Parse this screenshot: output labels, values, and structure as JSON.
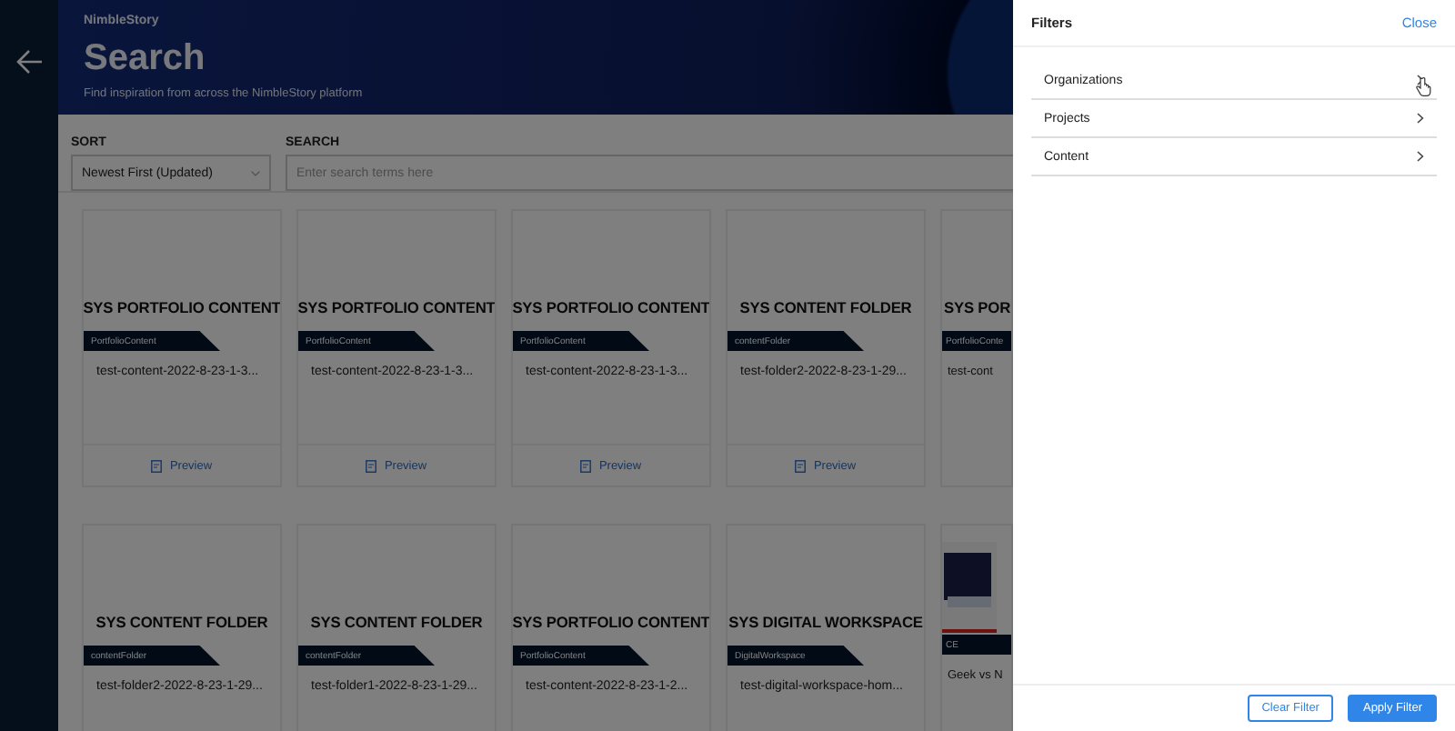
{
  "header": {
    "logo": "NimbleStory",
    "title": "Search",
    "subtitle": "Find inspiration from across the NimbleStory platform"
  },
  "sort": {
    "label": "SORT",
    "value": "Newest First (Updated)"
  },
  "search": {
    "label": "SEARCH",
    "placeholder": "Enter search terms here"
  },
  "card_rows": [
    {
      "cards": [
        {
          "kind": "text",
          "title": "SYS PORTFOLIO CONTENT",
          "tag": "PortfolioContent",
          "name": "test-content-2022-8-23-1-3...",
          "action": "Preview"
        },
        {
          "kind": "text",
          "title": "SYS PORTFOLIO CONTENT",
          "tag": "PortfolioContent",
          "name": "test-content-2022-8-23-1-3...",
          "action": "Preview"
        },
        {
          "kind": "text",
          "title": "SYS PORTFOLIO CONTENT",
          "tag": "PortfolioContent",
          "name": "test-content-2022-8-23-1-3...",
          "action": "Preview"
        },
        {
          "kind": "text",
          "title": "SYS CONTENT FOLDER",
          "tag": "contentFolder",
          "name": "test-folder2-2022-8-23-1-29...",
          "action": "Preview"
        },
        {
          "kind": "text",
          "title": "SYS POR",
          "tag": "PortfolioConte",
          "name": "test-cont",
          "partial": true
        }
      ]
    },
    {
      "cards": [
        {
          "kind": "text",
          "title": "SYS CONTENT FOLDER",
          "tag": "contentFolder",
          "name": "test-folder2-2022-8-23-1-29..."
        },
        {
          "kind": "text",
          "title": "SYS CONTENT FOLDER",
          "tag": "contentFolder",
          "name": "test-folder1-2022-8-23-1-29..."
        },
        {
          "kind": "text",
          "title": "SYS PORTFOLIO CONTENT",
          "tag": "PortfolioContent",
          "name": "test-content-2022-8-23-1-2..."
        },
        {
          "kind": "text",
          "title": "SYS DIGITAL WORKSPACE",
          "tag": "DigitalWorkspace",
          "name": "test-digital-workspace-hom..."
        },
        {
          "kind": "picture",
          "tag": "CE",
          "name": "Geek vs N",
          "partial": true
        }
      ]
    }
  ],
  "filters": {
    "title": "Filters",
    "close": "Close",
    "items": [
      {
        "label": "Organizations",
        "hovered": true
      },
      {
        "label": "Projects",
        "hovered": false
      },
      {
        "label": "Content",
        "hovered": false
      }
    ],
    "clear": "Clear Filter",
    "apply": "Apply Filter"
  }
}
